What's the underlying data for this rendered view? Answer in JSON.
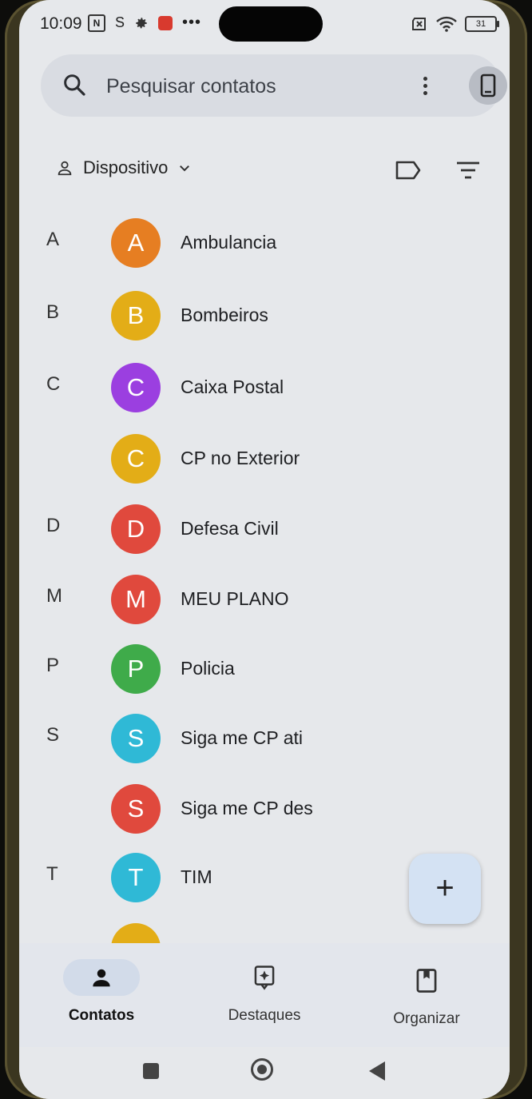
{
  "status_bar": {
    "time": "10:09",
    "nfc": "N",
    "s_icon": "S",
    "more": "•••",
    "battery": "31"
  },
  "search": {
    "placeholder": "Pesquisar contatos"
  },
  "filter": {
    "account_label": "Dispositivo"
  },
  "contacts": [
    {
      "letter": "A",
      "initial": "A",
      "name": "Ambulancia",
      "color": "#e67e22"
    },
    {
      "letter": "B",
      "initial": "B",
      "name": "Bombeiros",
      "color": "#e3ad17"
    },
    {
      "letter": "C",
      "initial": "C",
      "name": "Caixa Postal",
      "color": "#9b3fe0"
    },
    {
      "letter": "",
      "initial": "C",
      "name": "CP no Exterior",
      "color": "#e3ad17"
    },
    {
      "letter": "D",
      "initial": "D",
      "name": "Defesa Civil",
      "color": "#e0493d"
    },
    {
      "letter": "M",
      "initial": "M",
      "name": "MEU PLANO",
      "color": "#e0493d"
    },
    {
      "letter": "P",
      "initial": "P",
      "name": "Policia",
      "color": "#3fab4a"
    },
    {
      "letter": "S",
      "initial": "S",
      "name": "Siga me CP ati",
      "color": "#2fb9d6"
    },
    {
      "letter": "",
      "initial": "S",
      "name": "Siga me CP des",
      "color": "#e0493d"
    },
    {
      "letter": "T",
      "initial": "T",
      "name": "TIM",
      "color": "#2fb9d6"
    }
  ],
  "fab": {
    "symbol": "+"
  },
  "bottom_nav": {
    "contacts": "Contatos",
    "highlights": "Destaques",
    "organize": "Organizar"
  }
}
